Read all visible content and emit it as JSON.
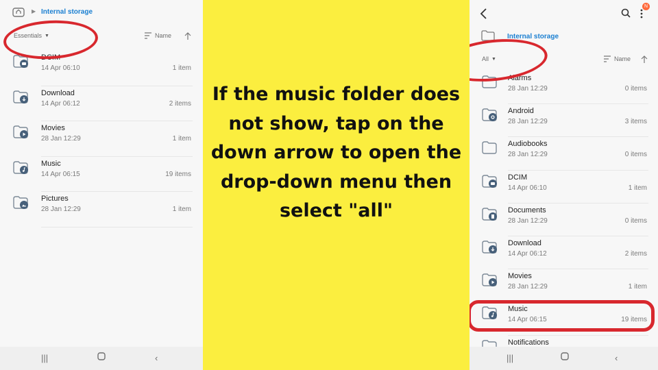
{
  "left": {
    "breadcrumb": "Internal storage",
    "filter_label": "Essentials",
    "sort_label": "Name",
    "folders": [
      {
        "name": "DCIM",
        "date": "14 Apr 06:10",
        "count": "1 item",
        "icon": "camera-folder-icon"
      },
      {
        "name": "Download",
        "date": "14 Apr 06:12",
        "count": "2 items",
        "icon": "download-folder-icon"
      },
      {
        "name": "Movies",
        "date": "28 Jan 12:29",
        "count": "1 item",
        "icon": "movies-folder-icon"
      },
      {
        "name": "Music",
        "date": "14 Apr 06:15",
        "count": "19 items",
        "icon": "music-folder-icon"
      },
      {
        "name": "Pictures",
        "date": "28 Jan 12:29",
        "count": "1 item",
        "icon": "pictures-folder-icon"
      }
    ]
  },
  "instruction": "If the music folder does not show, tap on the down arrow to open the drop-down menu then select \"all\"",
  "right": {
    "breadcrumb": "Internal storage",
    "notification_badge": "N",
    "filter_label": "All",
    "sort_label": "Name",
    "folders": [
      {
        "name": "Alarms",
        "date": "28 Jan 12:29",
        "count": "0 items",
        "icon": "folder-icon"
      },
      {
        "name": "Android",
        "date": "28 Jan 12:29",
        "count": "3 items",
        "icon": "settings-folder-icon"
      },
      {
        "name": "Audiobooks",
        "date": "28 Jan 12:29",
        "count": "0 items",
        "icon": "folder-icon"
      },
      {
        "name": "DCIM",
        "date": "14 Apr 06:10",
        "count": "1 item",
        "icon": "camera-folder-icon"
      },
      {
        "name": "Documents",
        "date": "28 Jan 12:29",
        "count": "0 items",
        "icon": "document-folder-icon"
      },
      {
        "name": "Download",
        "date": "14 Apr 06:12",
        "count": "2 items",
        "icon": "download-folder-icon"
      },
      {
        "name": "Movies",
        "date": "28 Jan 12:29",
        "count": "1 item",
        "icon": "movies-folder-icon"
      },
      {
        "name": "Music",
        "date": "14 Apr 06:15",
        "count": "19 items",
        "icon": "music-folder-icon"
      },
      {
        "name": "Notifications",
        "date": "",
        "count": "",
        "icon": "folder-icon"
      }
    ]
  },
  "colors": {
    "accent": "#1a7fd1",
    "highlight": "#fbee3f",
    "annotation": "#d8282e",
    "badge": "#ff6a3c"
  }
}
